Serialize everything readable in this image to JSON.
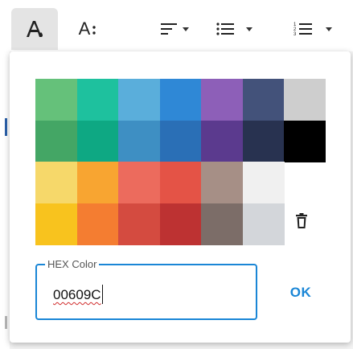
{
  "toolbar": {
    "items": [
      {
        "name": "text-color",
        "active": true
      },
      {
        "name": "font-size",
        "label": "A"
      },
      {
        "name": "align"
      },
      {
        "name": "bullet-list"
      },
      {
        "name": "numbered-list"
      }
    ]
  },
  "colors": {
    "rows": [
      [
        "#65c17a",
        "#1ec19e",
        "#5aaedb",
        "#2f88d6",
        "#8d5fb8",
        "#43527a",
        "#cecece"
      ],
      [
        "#44a665",
        "#0ea883",
        "#3e8fc3",
        "#2a6fb6",
        "#5b3a8e",
        "#283250",
        "#000000"
      ],
      [
        "#f6d86a",
        "#f8a531",
        "#ec6b5d",
        "#e45346",
        "#a68f86",
        "#f0f0f0",
        null
      ],
      [
        "#f8c31e",
        "#f47d31",
        "#d44b40",
        "#bd3232",
        "#7c6d68",
        "#d3d6da",
        null
      ]
    ]
  },
  "hex_field": {
    "label": "HEX Color",
    "value": "00609C"
  },
  "ok_label": "OK",
  "accent": "#1a86d6"
}
